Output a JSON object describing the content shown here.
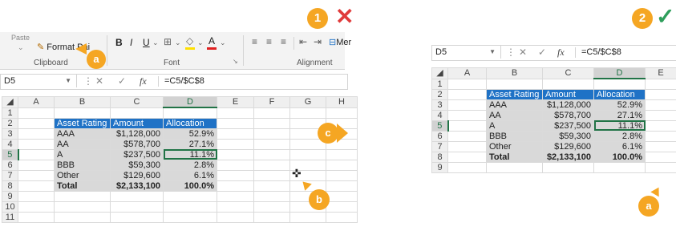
{
  "left": {
    "ribbon": {
      "paste_label": "Paste",
      "format_painter_label": "Format Pai",
      "bold": "B",
      "italic": "I",
      "underline": "U",
      "group_clipboard": "Clipboard",
      "group_font": "Font",
      "group_alignment": "Alignment",
      "merge_label": "Mer"
    },
    "formula_bar": {
      "name_box": "D5",
      "formula": "=C5/$C$8",
      "fx": "fx"
    },
    "columns": [
      "A",
      "B",
      "C",
      "D",
      "E",
      "F",
      "G",
      "H"
    ],
    "rows": [
      "1",
      "2",
      "3",
      "4",
      "5",
      "6",
      "7",
      "8",
      "9",
      "10",
      "11"
    ],
    "table": {
      "headers": [
        "Asset Rating",
        "Amount",
        "Allocation"
      ],
      "rows": [
        [
          "AAA",
          "$1,128,000",
          "52.9%"
        ],
        [
          "AA",
          "$578,700",
          "27.1%"
        ],
        [
          "A",
          "$237,500",
          "11.1%"
        ],
        [
          "BBB",
          "$59,300",
          "2.8%"
        ],
        [
          "Other",
          "$129,600",
          "6.1%"
        ],
        [
          "Total",
          "$2,133,100",
          "100.0%"
        ]
      ]
    },
    "callouts": {
      "a": "a",
      "b": "b",
      "c": "c"
    },
    "step_number": "1",
    "step_mark": "✕"
  },
  "right": {
    "formula_bar": {
      "name_box": "D5",
      "formula": "=C5/$C$8",
      "fx": "fx"
    },
    "columns": [
      "A",
      "B",
      "C",
      "D",
      "E"
    ],
    "rows": [
      "1",
      "2",
      "3",
      "4",
      "5",
      "6",
      "7",
      "8",
      "9"
    ],
    "table": {
      "headers": [
        "Asset Rating",
        "Amount",
        "Allocation"
      ],
      "rows": [
        [
          "AAA",
          "$1,128,000",
          "52.9%"
        ],
        [
          "AA",
          "$578,700",
          "27.1%"
        ],
        [
          "A",
          "$237,500",
          "11.1%"
        ],
        [
          "BBB",
          "$59,300",
          "2.8%"
        ],
        [
          "Other",
          "$129,600",
          "6.1%"
        ],
        [
          "Total",
          "$2,133,100",
          "100.0%"
        ]
      ]
    },
    "callouts": {
      "a": "a"
    },
    "step_number": "2",
    "step_mark": "✓"
  },
  "colors": {
    "accent_orange": "#f5a623",
    "wrong_red": "#e03a3a",
    "right_green": "#2e9e5b",
    "header_blue": "#1f72c6",
    "excel_green": "#217346"
  }
}
